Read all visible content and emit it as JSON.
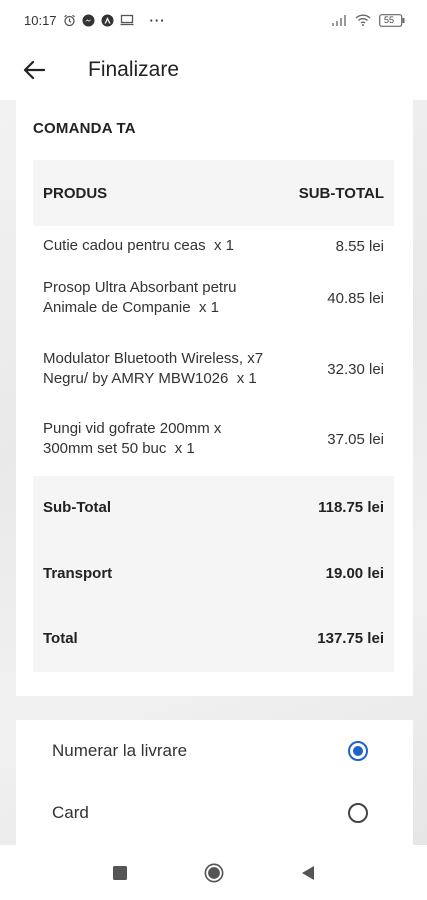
{
  "status_bar": {
    "time": "10:17",
    "left_icons": [
      "alarm-icon",
      "messenger-icon",
      "app-icon",
      "monitor-icon",
      "more-dots-icon"
    ],
    "more": "···",
    "battery": "55"
  },
  "app_bar": {
    "back_icon": "arrow-left-icon",
    "title": "Finalizare"
  },
  "order": {
    "title": "COMANDA TA",
    "columns": {
      "product": "PRODUS",
      "subtotal": "SUB-TOTAL"
    },
    "items": [
      {
        "name": "Cutie cadou pentru ceas",
        "qty": "x  1",
        "price": "8.55 lei"
      },
      {
        "name": "Prosop Ultra Absorbant petru Animale de Companie",
        "qty": "x  1",
        "price": "40.85 lei"
      },
      {
        "name": "Modulator Bluetooth Wireless, x7 Negru/ by AMRY MBW1026",
        "qty": "x  1",
        "price": "32.30 lei"
      },
      {
        "name": "Pungi vid gofrate 200mm x 300mm set 50 buc",
        "qty": "x  1",
        "price": "37.05 lei"
      }
    ],
    "totals": [
      {
        "label": "Sub-Total",
        "value": "118.75 lei"
      },
      {
        "label": "Transport",
        "value": "19.00 lei"
      },
      {
        "label": "Total",
        "value": "137.75 lei"
      }
    ]
  },
  "payment": {
    "options": [
      {
        "label": "Numerar la livrare",
        "selected": true
      },
      {
        "label": "Card",
        "selected": false
      }
    ]
  },
  "nav": [
    "recents-square-icon",
    "home-circle-icon",
    "back-triangle-icon"
  ],
  "colors": {
    "accent": "#1e63c6",
    "table_bg": "#f5f5f5"
  }
}
